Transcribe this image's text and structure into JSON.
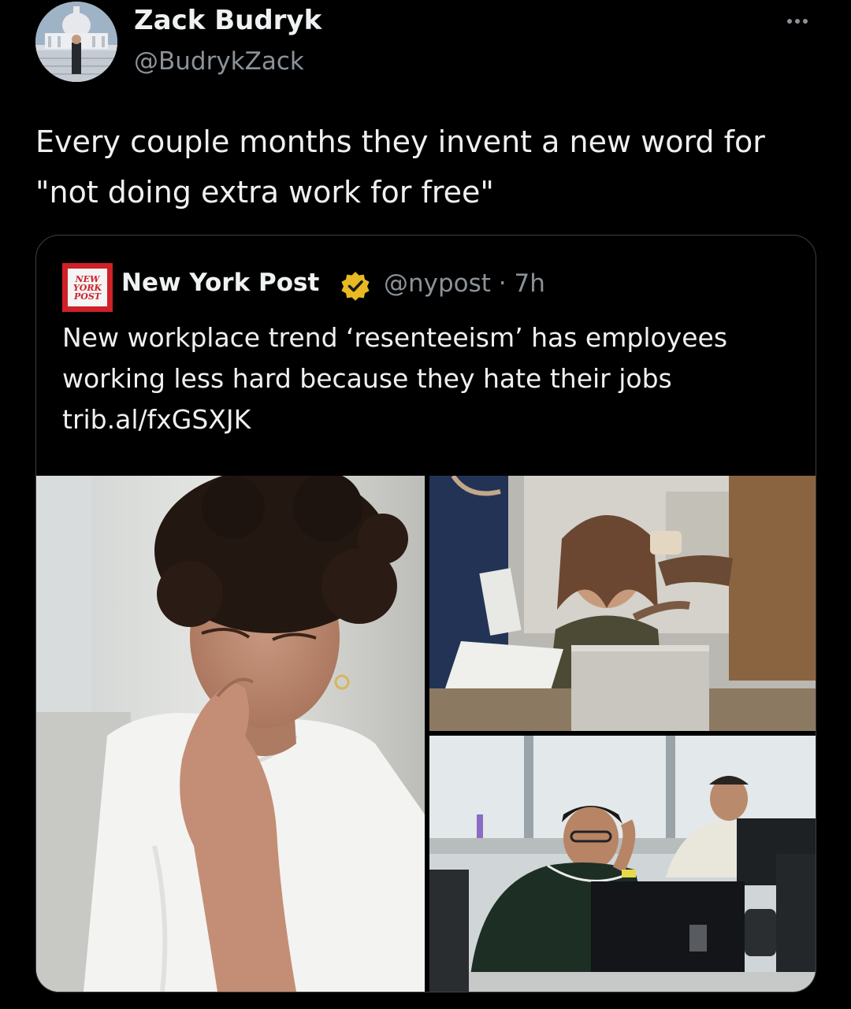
{
  "author": {
    "display_name": "Zack Budryk",
    "handle": "@BudrykZack",
    "avatar_icon": "avatar-capitol-photo"
  },
  "tweet": {
    "lines": [
      "Every couple months they invent a new word for",
      "\"not doing extra work for free\""
    ]
  },
  "quoted": {
    "logo_lines": [
      "NEW",
      "YORK",
      "POST"
    ],
    "display_name": "New York Post",
    "verified_icon": "verified-badge-icon",
    "verified_color": "#e8b923",
    "meta": "@nypost · 7h",
    "text_lines": [
      "New workplace trend ‘resenteeism’ has employees",
      "working less hard because they hate their jobs",
      "trib.al/fxGSXJK"
    ]
  },
  "colors": {
    "background": "#000000",
    "text": "#e7e9ea",
    "muted": "#8b9298",
    "border": "#3b3f44",
    "brand_red": "#d02028"
  }
}
